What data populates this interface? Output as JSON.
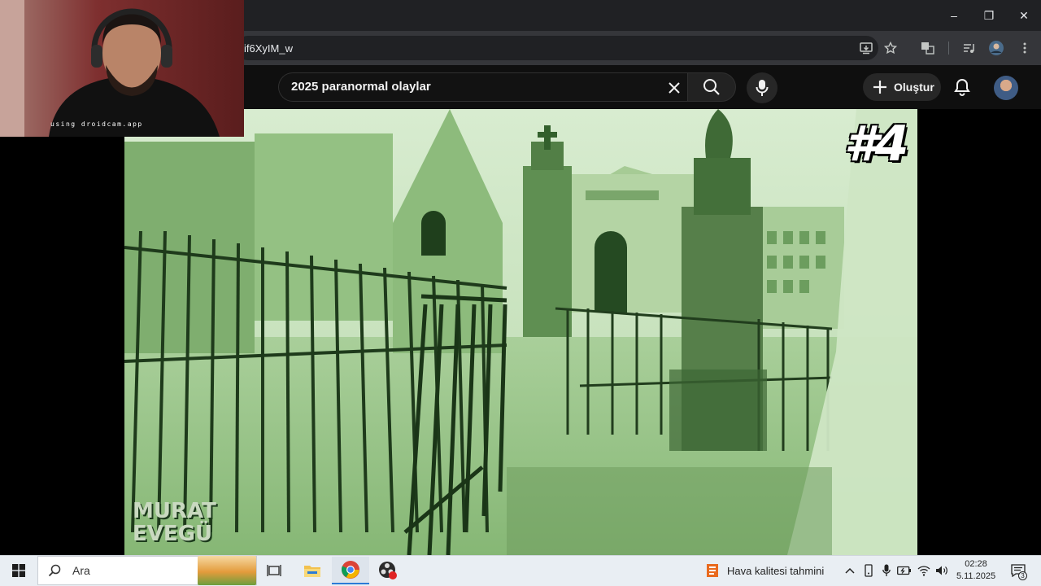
{
  "browser": {
    "url_fragment": "if6XyIM_w",
    "window_buttons": {
      "minimize": "–",
      "restore": "❐",
      "close": "✕"
    }
  },
  "youtube": {
    "search_value": "2025 paranormal olaylar",
    "create_label": "Oluştur"
  },
  "video": {
    "badge": "#4",
    "watermark_line1": "MURAT",
    "watermark_line2": "EVEGÜ"
  },
  "webcam": {
    "label": "using droidcam.app"
  },
  "taskbar": {
    "search_placeholder": "Ara",
    "weather_label": "Hava kalitesi tahmini",
    "time": "02:28",
    "date": "5.11.2025",
    "notification_count": "3"
  },
  "colors": {
    "youtube_bg": "#0f0f0f",
    "nightvision": "#b5d6a8",
    "taskbar": "#e9eef3"
  },
  "icons": {
    "search": "search-icon",
    "mic": "mic-icon",
    "bell": "bell-icon",
    "plus": "plus-icon"
  }
}
